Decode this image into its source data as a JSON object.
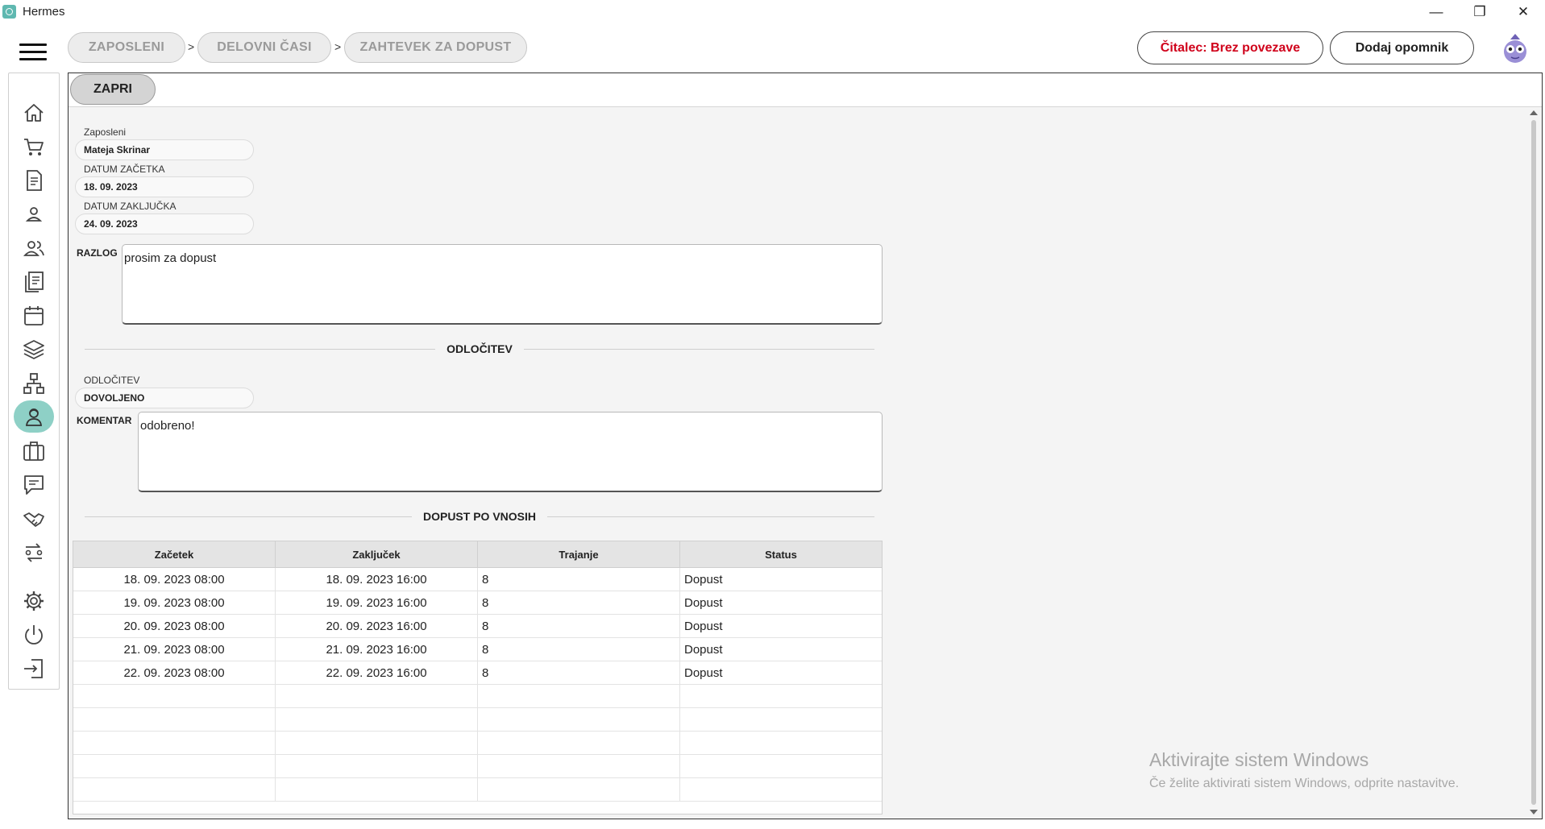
{
  "window": {
    "title": "Hermes",
    "controls": {
      "minimize": "—",
      "restore": "❐",
      "close": "✕"
    }
  },
  "header": {
    "breadcrumb": [
      "ZAPOSLENI",
      "DELOVNI ČASI",
      "ZAHTEVEK ZA DOPUST"
    ],
    "separator": ">",
    "reader_status": "Čitalec: Brez povezave",
    "reader_status_color": "#d0021b",
    "add_reminder": "Dodaj opomnik"
  },
  "sidebar": {
    "active_color": "#8ed0c6",
    "items": [
      {
        "icon": "home-icon"
      },
      {
        "icon": "cart-icon"
      },
      {
        "icon": "document-icon"
      },
      {
        "icon": "user-icon"
      },
      {
        "icon": "users-icon"
      },
      {
        "icon": "articles-icon"
      },
      {
        "icon": "calendar-icon"
      },
      {
        "icon": "layers-icon"
      },
      {
        "icon": "hierarchy-icon"
      },
      {
        "icon": "employee-icon",
        "active": true
      },
      {
        "icon": "briefcase-icon"
      },
      {
        "icon": "chat-icon"
      },
      {
        "icon": "handshake-icon"
      },
      {
        "icon": "transfer-icon"
      },
      {
        "icon": "settings-icon"
      },
      {
        "icon": "power-icon"
      },
      {
        "icon": "logout-icon"
      }
    ]
  },
  "main": {
    "close_label": "ZAPRI",
    "employee": {
      "label": "Zaposleni",
      "value": "Mateja Skrinar"
    },
    "start_date": {
      "label": "DATUM ZAČETKA",
      "value": "18. 09. 2023"
    },
    "end_date": {
      "label": "DATUM ZAKLJUČKA",
      "value": "24. 09. 2023"
    },
    "reason": {
      "label": "RAZLOG",
      "value": "prosim za dopust"
    },
    "decision_section": "ODLOČITEV",
    "decision": {
      "label": "ODLOČITEV",
      "value": "DOVOLJENO"
    },
    "comment": {
      "label": "KOMENTAR",
      "value": "odobreno!"
    },
    "entries_section": "DOPUST PO VNOSIH",
    "table": {
      "columns": [
        "Začetek",
        "Zaključek",
        "Trajanje",
        "Status"
      ],
      "rows": [
        [
          "18. 09. 2023 08:00",
          "18. 09. 2023 16:00",
          "8",
          "Dopust"
        ],
        [
          "19. 09. 2023 08:00",
          "19. 09. 2023 16:00",
          "8",
          "Dopust"
        ],
        [
          "20. 09. 2023 08:00",
          "20. 09. 2023 16:00",
          "8",
          "Dopust"
        ],
        [
          "21. 09. 2023 08:00",
          "21. 09. 2023 16:00",
          "8",
          "Dopust"
        ],
        [
          "22. 09. 2023 08:00",
          "22. 09. 2023 16:00",
          "8",
          "Dopust"
        ]
      ]
    }
  },
  "watermark": {
    "line1": "Aktivirajte sistem Windows",
    "line2": "Če želite aktivirati sistem Windows, odprite nastavitve."
  }
}
